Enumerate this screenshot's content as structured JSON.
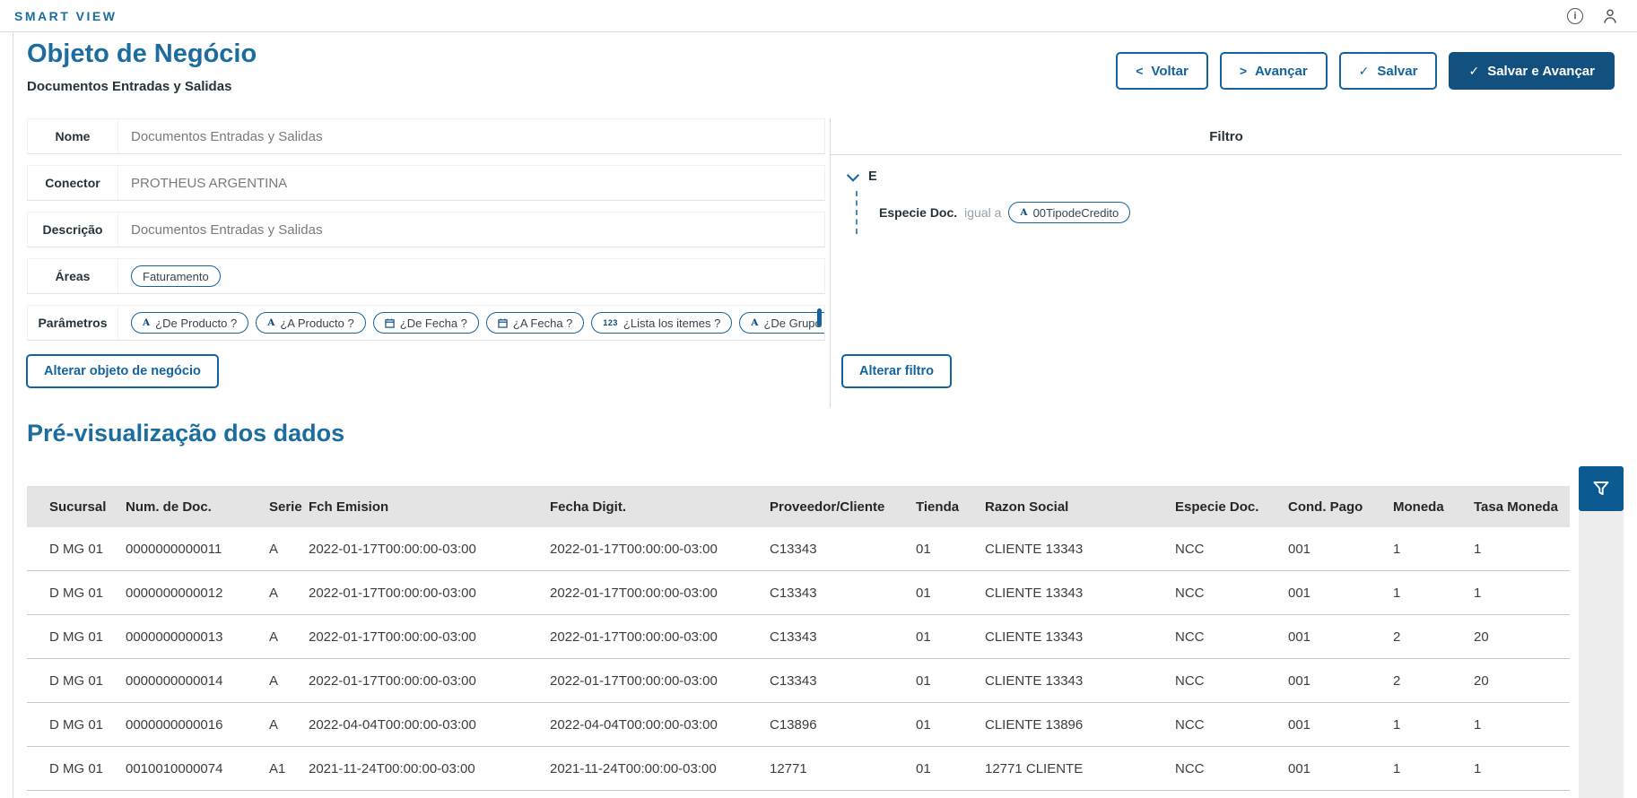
{
  "app": {
    "brand": "SMART VIEW"
  },
  "icons": {
    "info_glyph": "i",
    "text_param_glyph": "A",
    "number_param_glyph": "123"
  },
  "page": {
    "title": "Objeto de Negócio",
    "subtitle": "Documentos Entradas y Salidas",
    "actions": [
      {
        "label": "Voltar",
        "icon_glyph": "<"
      },
      {
        "label": "Avançar",
        "icon_glyph": ">"
      },
      {
        "label": "Salvar",
        "icon_glyph": "✓"
      },
      {
        "label": "Salvar e Avançar",
        "icon_glyph": "✓"
      }
    ]
  },
  "form": {
    "fields": [
      {
        "label": "Nome",
        "value": "Documentos Entradas y Salidas"
      },
      {
        "label": "Conector",
        "value": "PROTHEUS ARGENTINA"
      },
      {
        "label": "Descrição",
        "value": "Documentos Entradas y Salidas"
      },
      {
        "label": "Áreas",
        "chips": [
          {
            "label": "Faturamento"
          }
        ]
      },
      {
        "label": "Parâmetros",
        "chips": [
          {
            "icon": "text-icon",
            "glyph": "A",
            "label": "¿De Producto ?"
          },
          {
            "icon": "text-icon",
            "glyph": "A",
            "label": "¿A Producto ?"
          },
          {
            "icon": "calendar-icon",
            "glyph": "",
            "label": "¿De Fecha ?"
          },
          {
            "icon": "calendar-icon",
            "glyph": "",
            "label": "¿A Fecha ?"
          },
          {
            "icon": "number-icon",
            "glyph": "123",
            "label": "¿Lista los itemes ?"
          },
          {
            "icon": "text-icon",
            "glyph": "A",
            "label": "¿De Grupo ?"
          }
        ]
      }
    ],
    "change_button": "Alterar objeto de negócio"
  },
  "filter": {
    "title": "Filtro",
    "group_operator": "E",
    "condition": {
      "field": "Especie Doc.",
      "operator": "igual a",
      "chip_glyph": "A",
      "chip_value": "00TipodeCredito"
    },
    "change_button": "Alterar filtro"
  },
  "preview": {
    "title": "Pré-visualização dos dados",
    "columns": [
      "Sucursal",
      "Num. de Doc.",
      "Serie",
      "Fch Emision",
      "Fecha Digit.",
      "Proveedor/Cliente",
      "Tienda",
      "Razon Social",
      "Especie Doc.",
      "Cond. Pago",
      "Moneda",
      "Tasa Moneda"
    ],
    "rows": [
      [
        "D MG 01",
        "0000000000011",
        "A",
        "2022-01-17T00:00:00-03:00",
        "2022-01-17T00:00:00-03:00",
        "C13343",
        "01",
        "CLIENTE 13343",
        "NCC",
        "001",
        "1",
        "1"
      ],
      [
        "D MG 01",
        "0000000000012",
        "A",
        "2022-01-17T00:00:00-03:00",
        "2022-01-17T00:00:00-03:00",
        "C13343",
        "01",
        "CLIENTE 13343",
        "NCC",
        "001",
        "1",
        "1"
      ],
      [
        "D MG 01",
        "0000000000013",
        "A",
        "2022-01-17T00:00:00-03:00",
        "2022-01-17T00:00:00-03:00",
        "C13343",
        "01",
        "CLIENTE 13343",
        "NCC",
        "001",
        "2",
        "20"
      ],
      [
        "D MG 01",
        "0000000000014",
        "A",
        "2022-01-17T00:00:00-03:00",
        "2022-01-17T00:00:00-03:00",
        "C13343",
        "01",
        "CLIENTE 13343",
        "NCC",
        "001",
        "2",
        "20"
      ],
      [
        "D MG 01",
        "0000000000016",
        "A",
        "2022-04-04T00:00:00-03:00",
        "2022-04-04T00:00:00-03:00",
        "C13896",
        "01",
        "CLIENTE 13896",
        "NCC",
        "001",
        "1",
        "1"
      ],
      [
        "D MG 01",
        "0010010000074",
        "A1",
        "2021-11-24T00:00:00-03:00",
        "2021-11-24T00:00:00-03:00",
        "12771",
        "01",
        "12771 CLIENTE",
        "NCC",
        "001",
        "1",
        "1"
      ]
    ]
  },
  "colors": {
    "brand_blue": "#1a6d9e",
    "button_blue": "#15639e",
    "primary_button": "#11507f",
    "filter_button": "#0b5a91",
    "table_header_bg": "#e4e4e4",
    "row_separator": "#c9c9c9"
  }
}
